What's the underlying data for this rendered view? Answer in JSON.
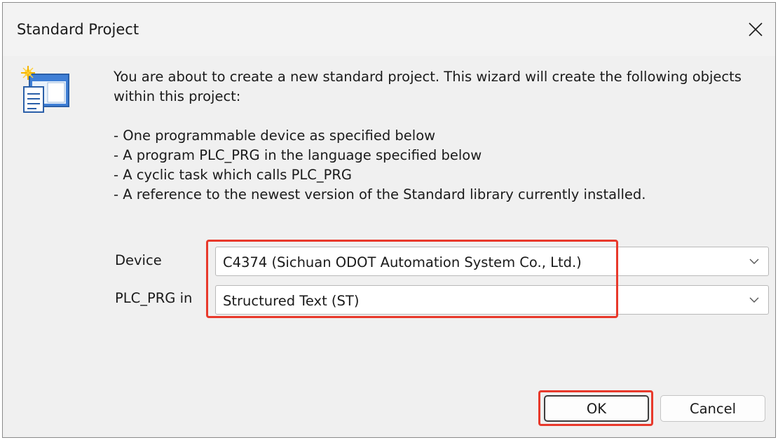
{
  "dialog": {
    "title": "Standard Project",
    "close_icon": "close-icon"
  },
  "intro": {
    "text": "You are about to create a new standard project. This wizard will create the following objects within this project:",
    "icon": "project-wizard-icon"
  },
  "bullets": [
    "- One programmable device as specified below",
    "- A program PLC_PRG in the language specified below",
    "- A cyclic task which calls PLC_PRG",
    "- A reference to the newest version of the Standard library currently installed."
  ],
  "form": {
    "device_label": "Device",
    "device_value": "C4374 (Sichuan ODOT Automation System Co., Ltd.)",
    "language_label": "PLC_PRG in",
    "language_value": "Structured Text (ST)"
  },
  "buttons": {
    "ok": "OK",
    "cancel": "Cancel"
  },
  "colors": {
    "highlight": "#e8392b",
    "dialog_bg": "#f0f0f0",
    "titlebar_bg": "#f3f3f3"
  }
}
